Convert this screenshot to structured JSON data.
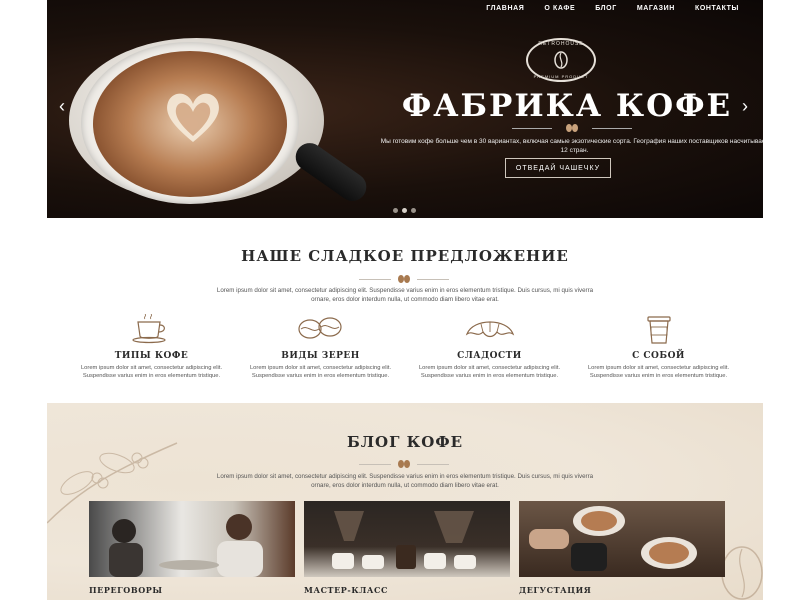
{
  "nav": {
    "items": [
      "ГЛАВНАЯ",
      "О КАФЕ",
      "БЛОГ",
      "МАГАЗИН",
      "КОНТАКТЫ"
    ]
  },
  "hero": {
    "logo_top": "RETROHOUSE",
    "logo_bottom": "PREMIUM PRODUCT",
    "title": "ФАБРИКА КОФЕ",
    "desc": "Мы готовим кофе больше чем в 30 вариантах, включая самые экзотические сорта. География наших поставщиков насчитывает 12 стран.",
    "button": "ОТВЕДАЙ ЧАШЕЧКУ",
    "prev_arrow": "‹",
    "next_arrow": "›",
    "slides": 3,
    "active_slide": 2
  },
  "offer": {
    "title": "НАШЕ СЛАДКОЕ ПРЕДЛОЖЕНИЕ",
    "text": "Lorem ipsum dolor sit amet, consectetur adipiscing elit. Suspendisse varius enim in eros elementum tristique. Duis cursus, mi quis viverra ornare, eros dolor interdum nulla, ut commodo diam libero vitae erat.",
    "features": [
      {
        "title": "ТИПЫ КОФЕ",
        "icon": "coffee-cup-icon",
        "desc": "Lorem ipsum dolor sit amet, consectetur adipiscing elit. Suspendisse varius enim in eros elementum tristique."
      },
      {
        "title": "ВИДЫ ЗЕРЕН",
        "icon": "coffee-beans-icon",
        "desc": "Lorem ipsum dolor sit amet, consectetur adipiscing elit. Suspendisse varius enim in eros elementum tristique."
      },
      {
        "title": "СЛАДОСТИ",
        "icon": "croissant-icon",
        "desc": "Lorem ipsum dolor sit amet, consectetur adipiscing elit. Suspendisse varius enim in eros elementum tristique."
      },
      {
        "title": "С СОБОЙ",
        "icon": "takeaway-cup-icon",
        "desc": "Lorem ipsum dolor sit amet, consectetur adipiscing elit. Suspendisse varius enim in eros elementum tristique."
      }
    ]
  },
  "blog": {
    "title": "БЛОГ КОФЕ",
    "text": "Lorem ipsum dolor sit amet, consectetur adipiscing elit. Suspendisse varius enim in eros elementum tristique. Duis cursus, mi quis viverra ornare, eros dolor interdum nulla, ut commodo diam libero vitae erat.",
    "cards": [
      {
        "title": "ПЕРЕГОВОРЫ"
      },
      {
        "title": "МАСТЕР-КЛАСС"
      },
      {
        "title": "ДЕГУСТАЦИЯ"
      }
    ]
  },
  "colors": {
    "hero_bg": "#1a100b",
    "accent": "#8b5a34",
    "blog_bg": "#efe6d9",
    "text_dark": "#2a2a2a"
  }
}
